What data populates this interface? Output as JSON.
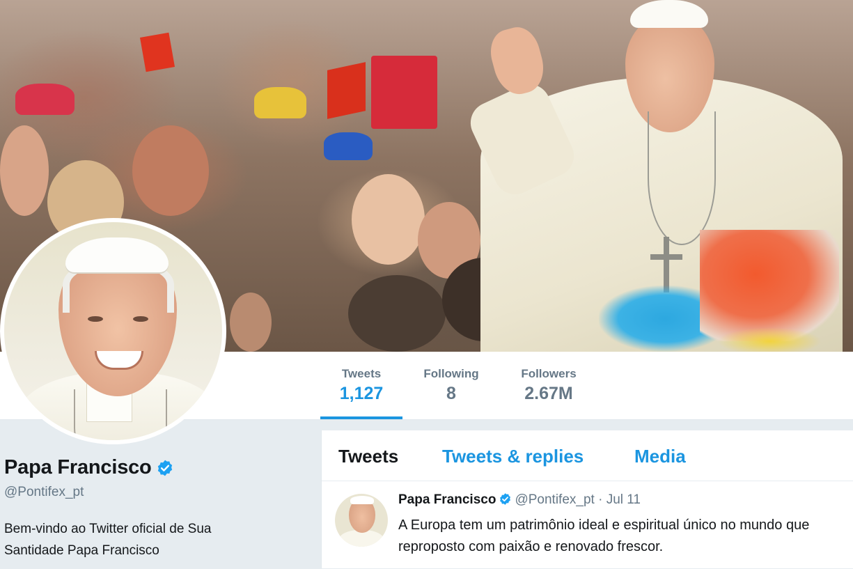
{
  "colors": {
    "accent": "#1b95e0",
    "page_background": "#e6ecf0",
    "secondary_text": "#657786",
    "primary_text": "#14171a"
  },
  "profile": {
    "name": "Papa Francisco",
    "handle": "@Pontifex_pt",
    "bio_line_1": "Bem-vindo ao Twitter oficial de Sua",
    "bio_line_2": "Santidade Papa Francisco",
    "verified_icon": "verified-badge-icon"
  },
  "stats": [
    {
      "label": "Tweets",
      "value": "1,127",
      "active": true
    },
    {
      "label": "Following",
      "value": "8",
      "active": false
    },
    {
      "label": "Followers",
      "value": "2.67M",
      "active": false
    }
  ],
  "timeline": {
    "tabs": [
      {
        "label": "Tweets",
        "active": true
      },
      {
        "label": "Tweets & replies",
        "active": false
      },
      {
        "label": "Media",
        "active": false
      }
    ],
    "tweet": {
      "name": "Papa Francisco",
      "handle": "@Pontifex_pt",
      "separator": "·",
      "date": "Jul 11",
      "text_line_1": "A Europa tem um patrimônio ideal e espiritual único no mundo que",
      "text_line_2": "reproposto com paixão e renovado frescor."
    }
  }
}
